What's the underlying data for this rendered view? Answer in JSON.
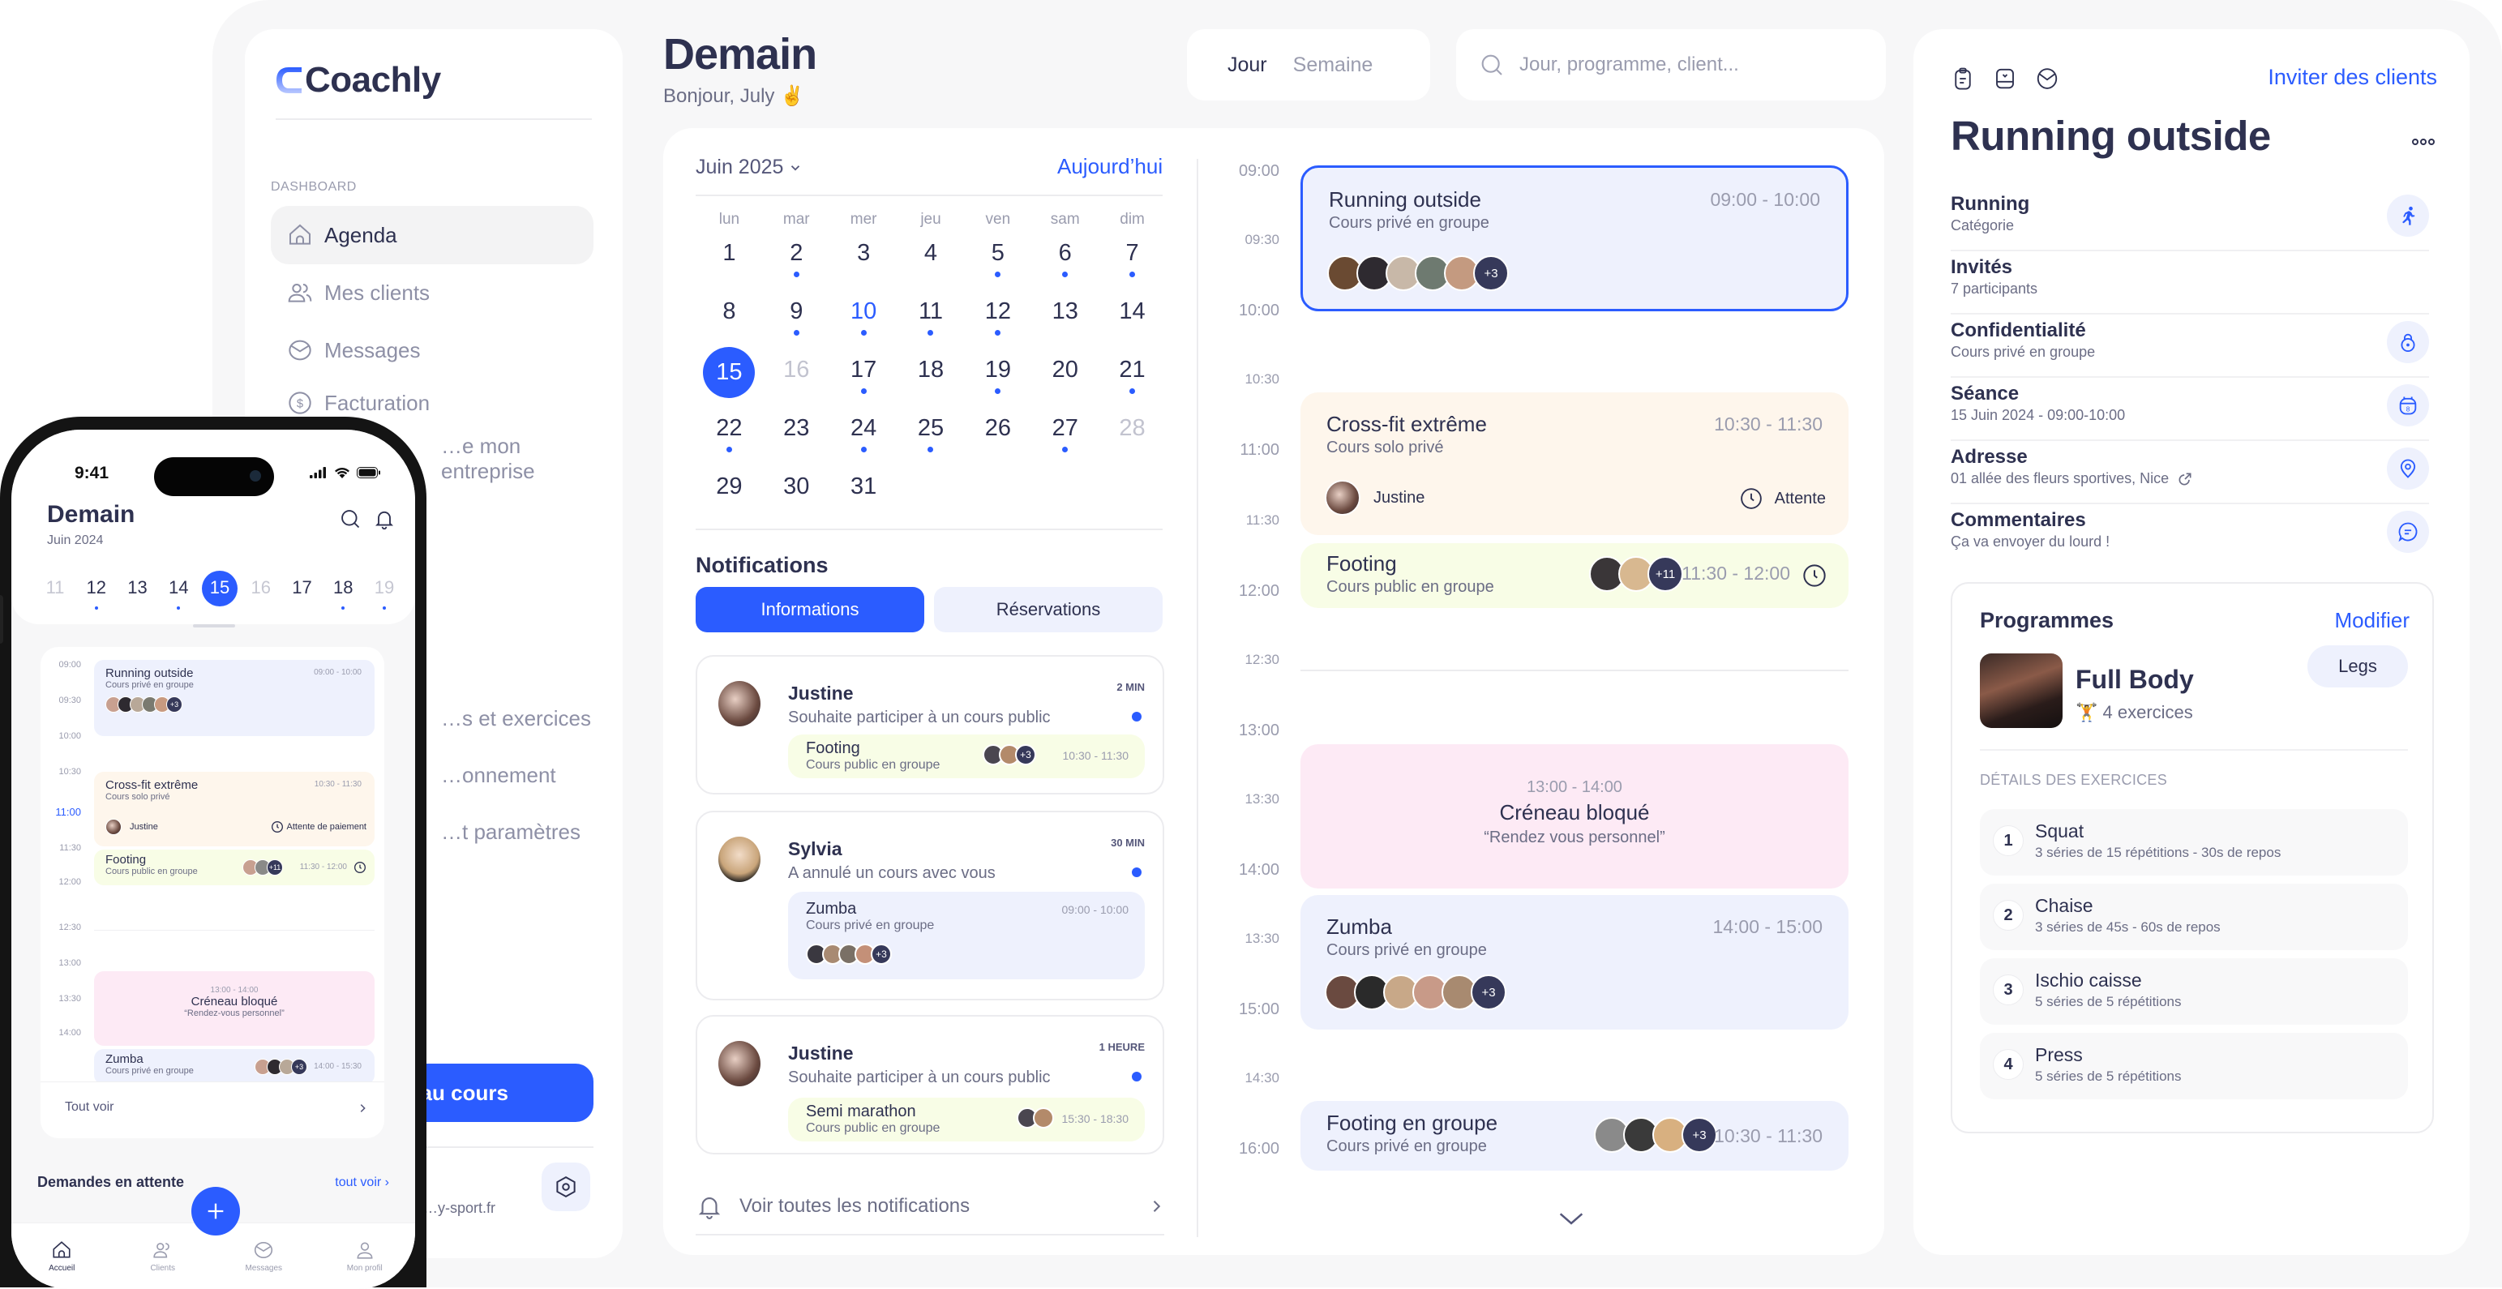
{
  "app": {
    "name": "Coachly",
    "brand_color": "#2b5cff"
  },
  "sidebar": {
    "section": "DASHBOARD",
    "items": [
      {
        "label": "Agenda",
        "icon": "home-icon",
        "active": true
      },
      {
        "label": "Mes clients",
        "icon": "users-icon"
      },
      {
        "label": "Messages",
        "icon": "mail-icon"
      },
      {
        "label": "Facturation",
        "icon": "dollar-icon"
      },
      {
        "label": "…e mon entreprise",
        "icon": "building-icon"
      },
      {
        "label": "…s et exercices",
        "icon": "dumbbell-icon"
      },
      {
        "label": "…onnement",
        "icon": "card-icon"
      },
      {
        "label": "…t paramètres",
        "icon": "gear-icon"
      }
    ],
    "new_course_button": "Nouveau cours",
    "domain_text": "…y-sport.fr",
    "settings_icon": "settings-icon"
  },
  "header": {
    "title": "Demain",
    "greeting": "Bonjour, July ✌️",
    "view_toggle": {
      "options": [
        "Jour",
        "Semaine"
      ],
      "selected": "Jour"
    },
    "search_placeholder": "Jour, programme, client..."
  },
  "calendar": {
    "month_label": "Juin 2025",
    "today_label": "Aujourd’hui",
    "weekdays": [
      "lun",
      "mar",
      "mer",
      "jeu",
      "ven",
      "sam",
      "dim"
    ],
    "days": [
      {
        "n": "1",
        "dot": false
      },
      {
        "n": "2",
        "dot": true
      },
      {
        "n": "3",
        "dot": false
      },
      {
        "n": "4",
        "dot": false
      },
      {
        "n": "5",
        "dot": true
      },
      {
        "n": "6",
        "dot": true
      },
      {
        "n": "7",
        "dot": true
      },
      {
        "n": "8",
        "dot": false
      },
      {
        "n": "9",
        "dot": true
      },
      {
        "n": "10",
        "dot": true,
        "state": "today"
      },
      {
        "n": "11",
        "dot": true
      },
      {
        "n": "12",
        "dot": true
      },
      {
        "n": "13",
        "dot": false
      },
      {
        "n": "14",
        "dot": false
      },
      {
        "n": "15",
        "dot": false,
        "state": "selected"
      },
      {
        "n": "16",
        "dot": false,
        "state": "muted"
      },
      {
        "n": "17",
        "dot": true
      },
      {
        "n": "18",
        "dot": false
      },
      {
        "n": "19",
        "dot": true
      },
      {
        "n": "20",
        "dot": false
      },
      {
        "n": "21",
        "dot": true
      },
      {
        "n": "22",
        "dot": true
      },
      {
        "n": "23",
        "dot": false
      },
      {
        "n": "24",
        "dot": true
      },
      {
        "n": "25",
        "dot": true
      },
      {
        "n": "26",
        "dot": false
      },
      {
        "n": "27",
        "dot": true
      },
      {
        "n": "28",
        "dot": false,
        "state": "muted"
      },
      {
        "n": "29",
        "dot": false
      },
      {
        "n": "30",
        "dot": false
      },
      {
        "n": "31",
        "dot": false
      }
    ]
  },
  "notifications": {
    "title": "Notifications",
    "tabs": [
      {
        "label": "Informations",
        "active": true
      },
      {
        "label": "Réservations",
        "active": false
      }
    ],
    "items": [
      {
        "name": "Justine",
        "message": "Souhaite participer à un cours public",
        "time": "2 MIN",
        "unread": true,
        "course": {
          "title": "Footing",
          "subtitle": "Cours public en groupe",
          "time": "10:30 - 11:30",
          "extra": "+3"
        }
      },
      {
        "name": "Sylvia",
        "message": "A annulé un cours avec vous",
        "time": "30 MIN",
        "unread": true,
        "course": {
          "title": "Zumba",
          "subtitle": "Cours privé en groupe",
          "time": "09:00 - 10:00",
          "extra": "+3"
        }
      },
      {
        "name": "Justine",
        "message": "Souhaite participer à un cours public",
        "time": "1 HEURE",
        "unread": true,
        "course": {
          "title": "Semi marathon",
          "subtitle": "Cours public en groupe",
          "time": "15:30 - 18:30"
        }
      }
    ],
    "see_all": "Voir toutes les notifications"
  },
  "schedule": {
    "times": [
      "09:00",
      "09:30",
      "10:00",
      "10:30",
      "11:00",
      "11:30",
      "12:00",
      "12:30",
      "13:00",
      "13:30",
      "14:00",
      "13:30",
      "15:00",
      "14:30",
      "16:00"
    ],
    "events": [
      {
        "title": "Running outside",
        "subtitle": "Cours privé en groupe",
        "time": "09:00 - 10:00",
        "extra": "+3",
        "selected": true
      },
      {
        "title": "Cross-fit extrême",
        "subtitle": "Cours solo privé",
        "time": "10:30 - 11:30",
        "client": "Justine",
        "status": "Attente"
      },
      {
        "title": "Footing",
        "subtitle": "Cours public en groupe",
        "time": "11:30 - 12:00",
        "extra": "+11"
      },
      {
        "time": "13:00 - 14:00",
        "title": "Créneau bloqué",
        "note": "“Rendez vous personnel”"
      },
      {
        "title": "Zumba",
        "subtitle": "Cours privé en groupe",
        "time": "14:00 - 15:00",
        "extra": "+3"
      },
      {
        "title": "Footing en groupe",
        "subtitle": "Cours privé en groupe",
        "time": "10:30 - 11:30",
        "extra": "+3"
      }
    ]
  },
  "detail": {
    "invite_link": "Inviter des clients",
    "title": "Running outside",
    "rows": [
      {
        "key": "Running",
        "value": "Catégorie",
        "icon": "running-icon"
      },
      {
        "key": "Invités",
        "value": "7 participants"
      },
      {
        "key": "Confidentialité",
        "value": "Cours privé en groupe",
        "icon": "lock-icon"
      },
      {
        "key": "Séance",
        "value": "15 Juin 2024 - 09:00-10:00",
        "icon": "calendar-icon"
      },
      {
        "key": "Adresse",
        "value": "01 allée des fleurs sportives, Nice",
        "icon": "location-icon"
      },
      {
        "key": "Commentaires",
        "value": "Ça va envoyer du lourd !",
        "icon": "comment-icon"
      }
    ],
    "program": {
      "heading": "Programmes",
      "edit": "Modifier",
      "name": "Full Body",
      "exercise_count": "🏋️ 4 exercices",
      "tag": "Legs",
      "section": "DÉTAILS DES EXERCICES",
      "exercises": [
        {
          "n": "1",
          "name": "Squat",
          "detail": "3 séries de 15 répétitions - 30s de repos"
        },
        {
          "n": "2",
          "name": "Chaise",
          "detail": "3 séries de 45s - 60s de repos"
        },
        {
          "n": "3",
          "name": "Ischio caisse",
          "detail": "5 séries de 5 répétitions"
        },
        {
          "n": "4",
          "name": "Press",
          "detail": "5 séries de 5 répétitions"
        }
      ]
    }
  },
  "phone": {
    "clock": "9:41",
    "title": "Demain",
    "subtitle": "Juin 2024",
    "week": [
      {
        "n": "11",
        "state": "muted"
      },
      {
        "n": "12",
        "dot": true
      },
      {
        "n": "13"
      },
      {
        "n": "14",
        "dot": true
      },
      {
        "n": "15",
        "state": "selected"
      },
      {
        "n": "16",
        "state": "muted"
      },
      {
        "n": "17"
      },
      {
        "n": "18",
        "dot": true
      },
      {
        "n": "19",
        "state": "muted",
        "dot": true
      }
    ],
    "times": [
      "09:00",
      "09:30",
      "10:00",
      "10:30",
      "11:00",
      "11:30",
      "12:00",
      "12:30",
      "13:00",
      "13:30",
      "14:00"
    ],
    "now_label": "11:00",
    "events": [
      {
        "title": "Running outside",
        "subtitle": "Cours privé en groupe",
        "time": "09:00 - 10:00",
        "extra": "+3"
      },
      {
        "title": "Cross-fit extrême",
        "subtitle": "Cours solo privé",
        "time": "10:30 - 11:30",
        "client": "Justine",
        "status": "Attente de paiement"
      },
      {
        "title": "Footing",
        "subtitle": "Cours public en groupe",
        "time": "11:30 - 12:00",
        "extra": "+11"
      },
      {
        "time": "13:00 - 14:00",
        "title": "Créneau bloqué",
        "note": "“Rendez-vous personnel”"
      },
      {
        "title": "Zumba",
        "subtitle": "Cours privé en groupe",
        "time": "14:00 - 15:30",
        "extra": "+3"
      }
    ],
    "see_all": "Tout voir",
    "pending_title": "Demandes en attente",
    "pending_link": "tout voir",
    "nav": [
      {
        "label": "Accueil",
        "active": true
      },
      {
        "label": "Clients"
      },
      {
        "label": "Messages"
      },
      {
        "label": "Mon profil"
      }
    ]
  }
}
